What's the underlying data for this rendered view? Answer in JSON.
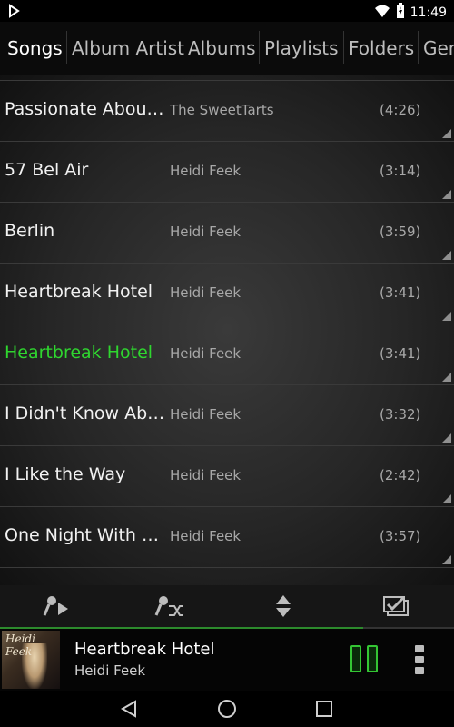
{
  "status_bar": {
    "time": "11:49",
    "icons": [
      "cast-icon",
      "wifi-icon",
      "battery-charging-icon"
    ]
  },
  "tabs": [
    {
      "label": "Songs",
      "active": true
    },
    {
      "label": "Album Artist",
      "active": false
    },
    {
      "label": "Albums",
      "active": false
    },
    {
      "label": "Playlists",
      "active": false
    },
    {
      "label": "Folders",
      "active": false
    },
    {
      "label": "Gen",
      "active": false
    }
  ],
  "songs": [
    {
      "title": "Passionate About...",
      "artist": "The SweetTarts",
      "duration": "(4:26)",
      "playing": false
    },
    {
      "title": "57 Bel Air",
      "artist": "Heidi Feek",
      "duration": "(3:14)",
      "playing": false
    },
    {
      "title": "Berlin",
      "artist": "Heidi Feek",
      "duration": "(3:59)",
      "playing": false
    },
    {
      "title": "Heartbreak Hotel",
      "artist": "Heidi Feek",
      "duration": "(3:41)",
      "playing": false
    },
    {
      "title": "Heartbreak Hotel",
      "artist": "Heidi Feek",
      "duration": "(3:41)",
      "playing": true
    },
    {
      "title": "I Didn't Know Abo...",
      "artist": "Heidi Feek",
      "duration": "(3:32)",
      "playing": false
    },
    {
      "title": "I Like the Way",
      "artist": "Heidi Feek",
      "duration": "(2:42)",
      "playing": false
    },
    {
      "title": "One Night With You",
      "artist": "Heidi Feek",
      "duration": "(3:57)",
      "playing": false
    }
  ],
  "toolbar": {
    "icons": [
      "play-artist-icon",
      "shuffle-artist-icon",
      "sort-icon",
      "select-multiple-icon"
    ]
  },
  "now_playing": {
    "title": "Heartbreak Hotel",
    "artist": "Heidi Feek",
    "album_art_text": "Heidi Feek",
    "progress": 0.8
  },
  "colors": {
    "accent": "#2fd62f",
    "background": "#262626"
  },
  "nav": {
    "icons": [
      "back-icon",
      "home-icon",
      "recents-icon"
    ]
  }
}
